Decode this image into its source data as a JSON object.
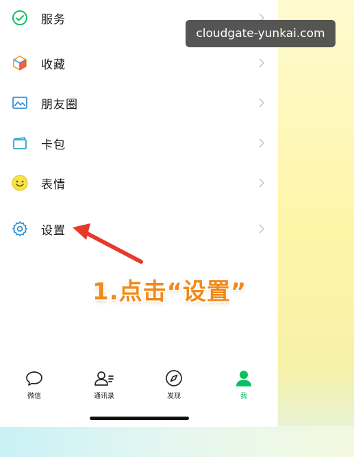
{
  "watermark": {
    "text": "cloudgate-yunkai.com"
  },
  "menu": {
    "items": [
      {
        "label": "服务",
        "icon": "services-icon"
      },
      {
        "label": "收藏",
        "icon": "favorites-cube-icon"
      },
      {
        "label": "朋友圈",
        "icon": "moments-photo-icon"
      },
      {
        "label": "卡包",
        "icon": "card-wallet-icon"
      },
      {
        "label": "表情",
        "icon": "sticker-smiley-icon"
      },
      {
        "label": "设置",
        "icon": "settings-gear-icon"
      }
    ]
  },
  "annotation": {
    "text": "1.点击“设置”",
    "color": "#f08a1c"
  },
  "tabbar": {
    "items": [
      {
        "label": "微信",
        "icon": "chat-bubble-icon",
        "active": false
      },
      {
        "label": "通讯录",
        "icon": "contacts-icon",
        "active": false
      },
      {
        "label": "发现",
        "icon": "compass-icon",
        "active": false
      },
      {
        "label": "我",
        "icon": "me-person-icon",
        "active": true
      }
    ]
  },
  "colors": {
    "accent": "#07c160",
    "arrow": "#e8392b",
    "annotation": "#f08a1c"
  }
}
